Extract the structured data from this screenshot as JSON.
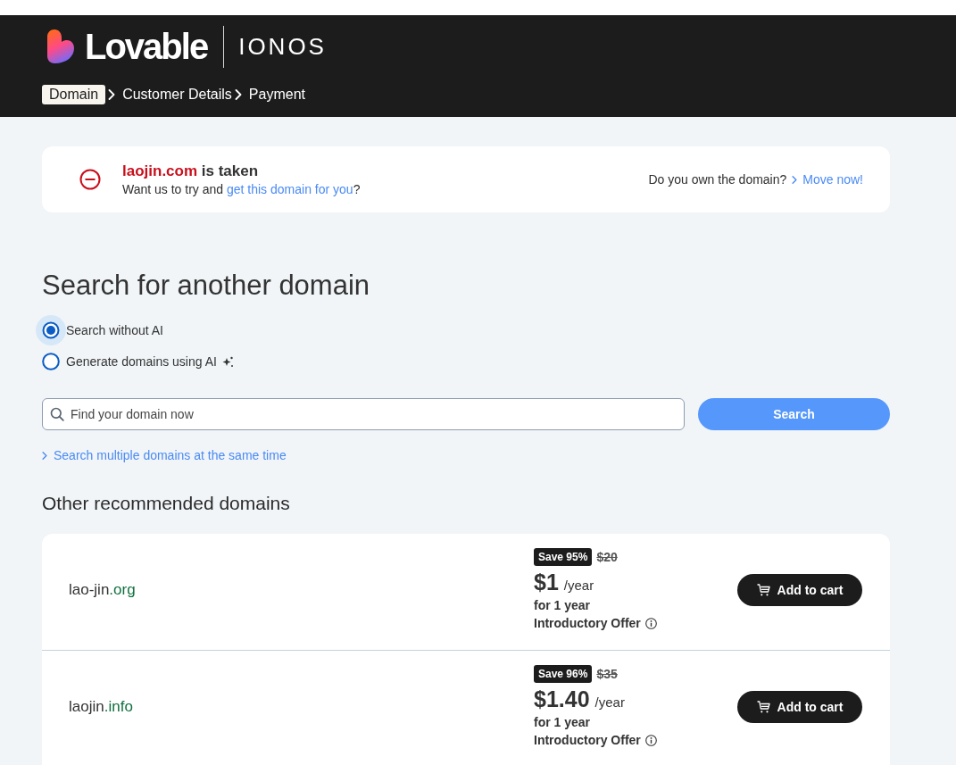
{
  "header": {
    "logo_text": "Lovable",
    "partner_text": "IONOS",
    "steps": [
      {
        "label": "Domain",
        "selected": true
      },
      {
        "label": "Customer Details",
        "selected": false
      },
      {
        "label": "Payment",
        "selected": false
      }
    ]
  },
  "alert": {
    "domain": "laojin.com",
    "status": "is taken",
    "message_before": "Want us to try and",
    "message_link": "get this domain for you",
    "message_after": "?",
    "question": "Do you own the domain?",
    "action_link": "Move now!"
  },
  "search": {
    "heading": "Search for another domain",
    "modes": [
      {
        "label": "Search without AI",
        "selected": true,
        "kind": "plain"
      },
      {
        "label": "Generate domains using AI",
        "selected": false,
        "kind": "ai"
      }
    ],
    "placeholder": "Find your domain now",
    "button": "Search",
    "multi_link": "Search multiple domains at the same time"
  },
  "recommendations": {
    "heading": "Other recommended domains",
    "domains": [
      {
        "name": "lao-jin",
        "tld": ".org",
        "badge": "Save 95%",
        "old_price": "$20",
        "price": "$1",
        "period": "/year",
        "term": "for 1 year",
        "offer": "Introductory Offer",
        "button": "Add to cart"
      },
      {
        "name": "laojin",
        "tld": ".info",
        "badge": "Save 96%",
        "old_price": "$35",
        "price": "$1.40",
        "period": "/year",
        "term": "for 1 year",
        "offer": "Introductory Offer",
        "button": "Add to cart"
      }
    ]
  }
}
